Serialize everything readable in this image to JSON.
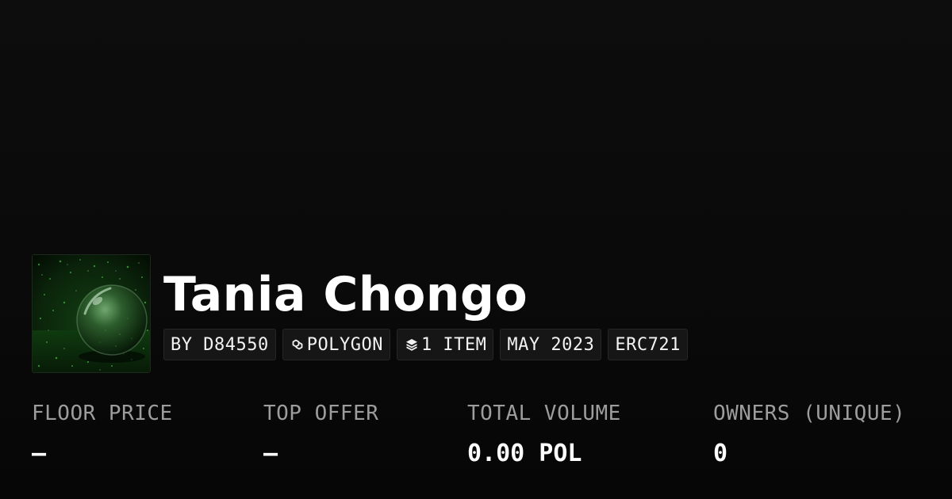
{
  "collection": {
    "title": "Tania Chongo",
    "thumbnail_icon": "green-crystal-ball-image",
    "badges": {
      "creator": "BY D84550",
      "chain": "POLYGON",
      "chain_icon": "polygon-chain-icon",
      "items": "1 ITEM",
      "items_icon": "layers-icon",
      "date": "MAY 2023",
      "standard": "ERC721"
    }
  },
  "stats": {
    "floor_price": {
      "label": "FLOOR PRICE",
      "value": "–"
    },
    "top_offer": {
      "label": "TOP OFFER",
      "value": "–"
    },
    "total_volume": {
      "label": "TOTAL VOLUME",
      "value": "0.00 POL"
    },
    "owners": {
      "label": "OWNERS (UNIQUE)",
      "value": "0"
    }
  },
  "colors": {
    "background": "#0a0a0a",
    "badge_background": "#161616",
    "label_gray": "#9d9d9d",
    "text": "#ffffff",
    "thumbnail_green": "#1f7a1f"
  }
}
